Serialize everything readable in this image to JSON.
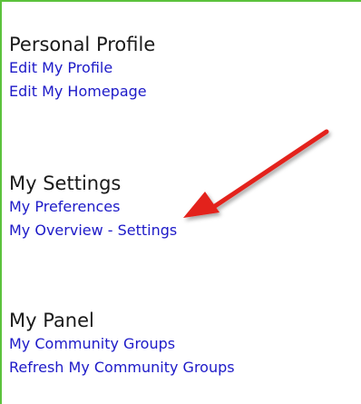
{
  "sections": [
    {
      "title": "Personal Profile",
      "links": [
        "Edit My Profile",
        "Edit My Homepage"
      ]
    },
    {
      "title": "My Settings",
      "links": [
        "My Preferences",
        "My Overview - Settings"
      ]
    },
    {
      "title": "My Panel",
      "links": [
        "My Community Groups",
        "Refresh My Community Groups"
      ]
    }
  ],
  "colors": {
    "border": "#5cc23c",
    "link": "#1d1ac8",
    "heading": "#1a1a1a",
    "arrow": "#e3231b"
  },
  "icons": {
    "pointer": "red-arrow-icon"
  }
}
